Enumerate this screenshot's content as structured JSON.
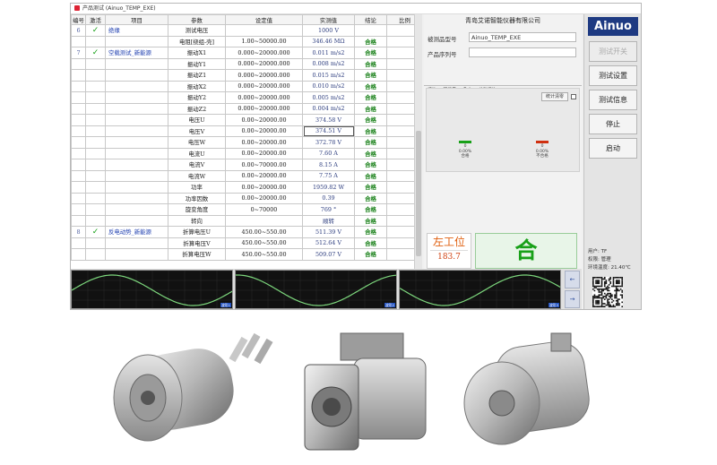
{
  "window_title": "产品测试 (Ainuo_TEMP_EXE)",
  "table": {
    "headers": [
      "编号",
      "激活",
      "项目",
      "参数",
      "设定值",
      "实测值",
      "结论",
      "比例"
    ],
    "rows": [
      {
        "num": "6",
        "check": "✓",
        "item": "绝缘",
        "param": "测试电压",
        "setting": "",
        "measured": "1000 V",
        "result": ""
      },
      {
        "num": "",
        "check": "",
        "item": "",
        "param": "电阻[绕组-壳]",
        "setting": "1.00~50000.00",
        "measured": "346.46 MΩ",
        "result": "合格"
      },
      {
        "num": "7",
        "check": "✓",
        "item": "空载测试_新能源",
        "param": "振动X1",
        "setting": "0.000~20000.000",
        "measured": "0.011 m/s2",
        "result": "合格"
      },
      {
        "num": "",
        "check": "",
        "item": "",
        "param": "振动Y1",
        "setting": "0.000~20000.000",
        "measured": "0.008 m/s2",
        "result": "合格"
      },
      {
        "num": "",
        "check": "",
        "item": "",
        "param": "振动Z1",
        "setting": "0.000~20000.000",
        "measured": "0.015 m/s2",
        "result": "合格"
      },
      {
        "num": "",
        "check": "",
        "item": "",
        "param": "振动X2",
        "setting": "0.000~20000.000",
        "measured": "0.010 m/s2",
        "result": "合格"
      },
      {
        "num": "",
        "check": "",
        "item": "",
        "param": "振动Y2",
        "setting": "0.000~20000.000",
        "measured": "0.005 m/s2",
        "result": "合格"
      },
      {
        "num": "",
        "check": "",
        "item": "",
        "param": "振动Z2",
        "setting": "0.000~20000.000",
        "measured": "0.004 m/s2",
        "result": "合格"
      },
      {
        "num": "",
        "check": "",
        "item": "",
        "param": "电压U",
        "setting": "0.00~20000.00",
        "measured": "374.58 V",
        "result": "合格"
      },
      {
        "num": "",
        "check": "",
        "item": "",
        "param": "电压V",
        "setting": "0.00~20000.00",
        "measured": "374.51 V",
        "result": "合格"
      },
      {
        "num": "",
        "check": "",
        "item": "",
        "param": "电压W",
        "setting": "0.00~20000.00",
        "measured": "372.78 V",
        "result": "合格"
      },
      {
        "num": "",
        "check": "",
        "item": "",
        "param": "电流U",
        "setting": "0.00~20000.00",
        "measured": "7.60 A",
        "result": "合格"
      },
      {
        "num": "",
        "check": "",
        "item": "",
        "param": "电流V",
        "setting": "0.00~70000.00",
        "measured": "8.15 A",
        "result": "合格"
      },
      {
        "num": "",
        "check": "",
        "item": "",
        "param": "电流W",
        "setting": "0.00~20000.00",
        "measured": "7.75 A",
        "result": "合格"
      },
      {
        "num": "",
        "check": "",
        "item": "",
        "param": "功率",
        "setting": "0.00~20000.00",
        "measured": "1959.82 W",
        "result": "合格"
      },
      {
        "num": "",
        "check": "",
        "item": "",
        "param": "功率因数",
        "setting": "0.00~20000.00",
        "measured": "0.39",
        "result": "合格"
      },
      {
        "num": "",
        "check": "",
        "item": "",
        "param": "旋变角度",
        "setting": "0~70000",
        "measured": "769 °",
        "result": "合格"
      },
      {
        "num": "",
        "check": "",
        "item": "",
        "param": "转向",
        "setting": "",
        "measured": "顺转",
        "result": "合格"
      },
      {
        "num": "8",
        "check": "✓",
        "item": "反电动势_新能源",
        "param": "折算电压U",
        "setting": "450.00~550.00",
        "measured": "511.39 V",
        "result": "合格"
      },
      {
        "num": "",
        "check": "",
        "item": "",
        "param": "折算电压V",
        "setting": "450.00~550.00",
        "measured": "512.64 V",
        "result": "合格"
      },
      {
        "num": "",
        "check": "",
        "item": "",
        "param": "折算电压W",
        "setting": "450.00~550.00",
        "measured": "509.07 V",
        "result": "合格"
      }
    ]
  },
  "company": "青岛艾诺智能仪器有限公司",
  "model_label": "被测品型号",
  "model_value": "Ainuo_TEMP_EXE",
  "serial_label": "产品序列号",
  "serial_value": "",
  "tabs": [
    "统计",
    "环境量",
    "Cpk",
    "总数统计"
  ],
  "clear_stats": "统计清零",
  "stats": {
    "pass_count": "0",
    "pass_rate": "0.00%",
    "pass_label": "合格",
    "fail_count": "0",
    "fail_rate": "0.00%",
    "fail_label": "不合格"
  },
  "station_label": "左工位",
  "station_value": "183.7",
  "verdict": "合格",
  "sidebar": {
    "logo": "Ainuo",
    "buttons": [
      "测试开关",
      "测试设置",
      "测试信息",
      "停止",
      "启动"
    ],
    "user": "用户: TF",
    "permission": "权限: 管理",
    "ambient": "环境温度: 21.40℃"
  },
  "waveforms": {
    "tags": [
      "波形1",
      "波形2",
      "波形3"
    ]
  },
  "colors": {
    "logo_bg": "#1e3a82",
    "pass": "#18a018",
    "fail": "#d03010",
    "wave": "#7cd67c"
  }
}
